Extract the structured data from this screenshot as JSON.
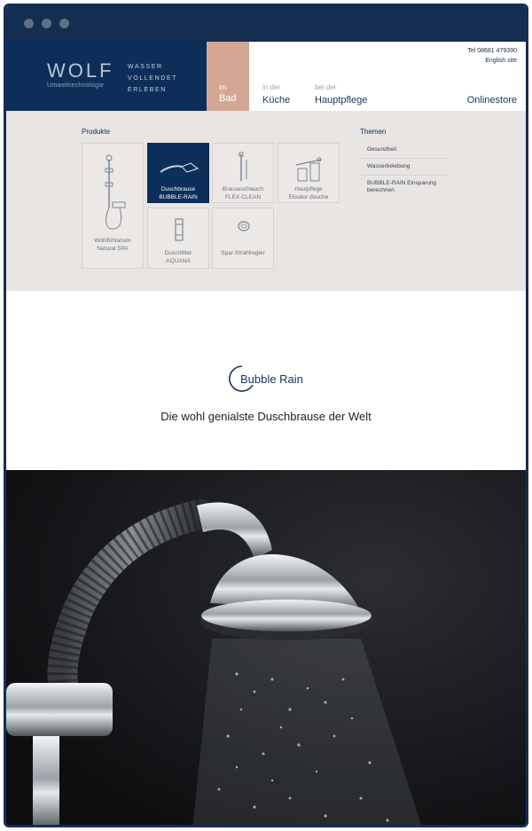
{
  "brand": {
    "logo": "WOLF",
    "subtitle": "Umwelttechnologie",
    "tagline": [
      "WASSER",
      "VOLLENDET",
      "ERLEBEN"
    ]
  },
  "nav": {
    "items": [
      {
        "small": "im",
        "label": "Bad",
        "active": true
      },
      {
        "small": "in der",
        "label": "Küche",
        "active": false
      },
      {
        "small": "bei der",
        "label": "Hauptpflege",
        "active": false
      }
    ],
    "onlinestore": "Onlinestore",
    "phone": "Tel 08681 479390",
    "english": "English site"
  },
  "mega": {
    "produkte_title": "Produkte",
    "themen_title": "Themen",
    "products": [
      {
        "line1": "Wohlfühlarium",
        "line2": "Natural SPA",
        "icon": "shower-rail-icon"
      },
      {
        "line1": "Duschbrause",
        "line2": "BUBBLE-RAIN",
        "icon": "shower-head-icon",
        "active": true
      },
      {
        "line1": "Brauseschlauch",
        "line2": "FLEX-CLEAN",
        "icon": "hose-icon"
      },
      {
        "line1": "Hautpflege",
        "line2": "Elixator douche",
        "icon": "skin-care-icon"
      },
      {
        "line1": "Duschfilter",
        "line2": "AQUANA",
        "icon": "filter-icon"
      },
      {
        "line1": "Spar-Strahlregler",
        "line2": "",
        "icon": "aerator-icon"
      }
    ],
    "themen": [
      "Gesundheit",
      "Wasserbelebung",
      "BUBBLE-RAIN Einsparung berechnen"
    ]
  },
  "hero": {
    "brand_name": "Bubble Rain",
    "headline": "Die wohl genialste Duschbrause der Welt"
  },
  "colors": {
    "navy": "#0c2f5a",
    "rose": "#d4a794",
    "menu_bg": "#e8e5e3"
  }
}
